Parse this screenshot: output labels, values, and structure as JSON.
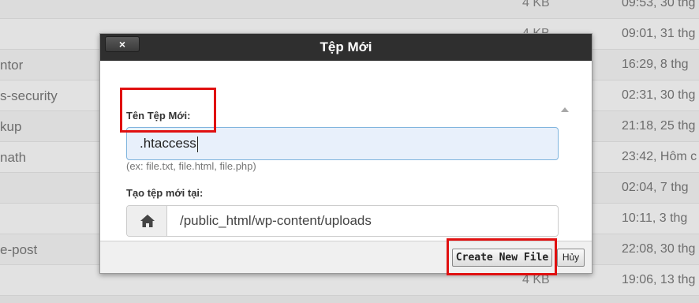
{
  "background_rows": [
    {
      "name": "",
      "size": "4 KB",
      "date": "09:53, 30 thg"
    },
    {
      "name": "",
      "size": "4 KB",
      "date": "09:01, 31 thg"
    },
    {
      "name": "ntor",
      "size": "",
      "date": "16:29, 8 thg"
    },
    {
      "name": "s-security",
      "size": "",
      "date": "02:31, 30 thg"
    },
    {
      "name": "kup",
      "size": "",
      "date": "21:18, 25 thg"
    },
    {
      "name": "nath",
      "size": "",
      "date": "23:42, Hôm c"
    },
    {
      "name": "",
      "size": "",
      "date": "02:04, 7 thg"
    },
    {
      "name": "",
      "size": "",
      "date": "10:11, 3 thg"
    },
    {
      "name": "e-post",
      "size": "",
      "date": "22:08, 30 thg"
    },
    {
      "name": "",
      "size": "4 KB",
      "date": "19:06, 13 thg"
    }
  ],
  "modal": {
    "title": "Tệp Mới",
    "close_glyph": "×",
    "filename_label": "Tên Tệp Mới:",
    "filename_value": ".htaccess",
    "filename_hint": "(ex: file.txt, file.html, file.php)",
    "location_label": "Tạo tệp mới tại:",
    "location_icon": "home-icon",
    "location_value": "/public_html/wp-content/uploads",
    "create_button": "Create New File",
    "cancel_button": "Hủy"
  },
  "colors": {
    "header_bg": "#2f2f2f",
    "highlight": "#e01010",
    "input_bg": "#e8f0fb",
    "input_border": "#80b5de"
  }
}
